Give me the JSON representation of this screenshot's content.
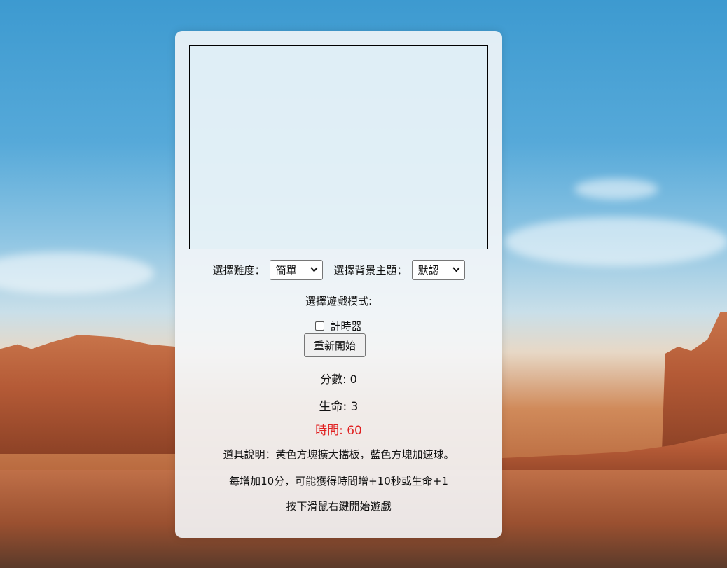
{
  "settings": {
    "difficulty_label": "選擇難度：",
    "difficulty_value": "簡單",
    "theme_label": "選擇背景主題：",
    "theme_value": "默認",
    "mode_label": "選擇遊戲模式:",
    "timer_checkbox_label": "計時器",
    "timer_checked": false
  },
  "restart_button": "重新開始",
  "stats": {
    "score": "分數: 0",
    "lives": "生命: 3",
    "time": "時間: 60",
    "time_color": "#e02020"
  },
  "instructions": {
    "items_desc": "道具說明：黃色方塊擴大擋板，藍色方塊加速球。",
    "bonus_desc": "每增加10分，可能獲得時間增+10秒或生命+1",
    "start_hint": "按下滑鼠右鍵開始遊戲"
  },
  "icons": {
    "select_arrow": "chevron-down-icon"
  }
}
